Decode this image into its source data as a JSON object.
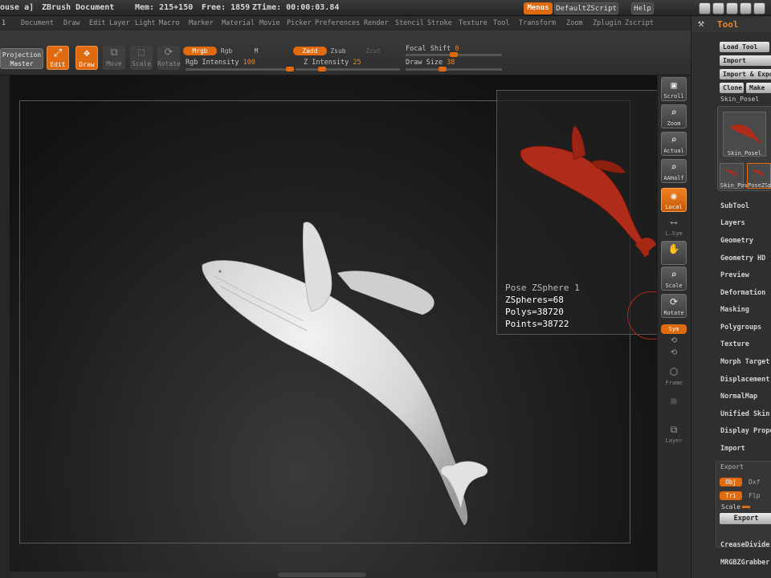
{
  "titlebar": {
    "doc_fragment": "ouse a]",
    "doc_title": "ZBrush Document",
    "mem": "Mem: 215+150",
    "free": "Free: 1859",
    "ztime": "ZTime: 00:00:03.84",
    "menus_btn": "Menus",
    "script_btn": "DefaultZScript",
    "help_btn": "Help"
  },
  "menubar": {
    "items": [
      "Document",
      "Draw",
      "Edit",
      "Layer",
      "Light",
      "Macro",
      "Marker",
      "Material",
      "Movie",
      "Picker",
      "Preferences",
      "Render",
      "Stencil",
      "Stroke",
      "Texture",
      "Tool",
      "Transform",
      "Zoom",
      "Zplugin",
      "Zscript"
    ]
  },
  "toolbar": {
    "projection_master": "Projection Master",
    "edit": "Edit",
    "draw": "Draw",
    "move": "Move",
    "scale": "Scale",
    "rotate": "Rotate",
    "mrgb": "Mrgb",
    "rgb": "Rgb",
    "m": "M",
    "zadd": "Zadd",
    "zsub": "Zsub",
    "zcut": "Zcut",
    "rgb_intensity_label": "Rgb Intensity",
    "rgb_intensity_value": "100",
    "z_intensity_label": "Z Intensity",
    "z_intensity_value": "25",
    "focal_shift_label": "Focal Shift",
    "focal_shift_value": "0",
    "draw_size_label": "Draw Size",
    "draw_size_value": "38",
    "rgb_intensity_level": 1.0,
    "z_intensity_level": 0.25,
    "draw_size_level": 0.38
  },
  "inset": {
    "info_title": "Pose ZSphere 1",
    "zspheres": "ZSpheres=68",
    "polys": "Polys=38720",
    "points": "Points=38722"
  },
  "shelf": {
    "scroll": "Scroll",
    "zoom": "Zoom",
    "actual": "Actual",
    "aahalf": "AAHalf",
    "local": "Local",
    "lsym": "L.Sym",
    "scale": "Scale",
    "rotate": "Rotate",
    "sym_pill": "Sym",
    "frame": "Frame",
    "layer": "Layer"
  },
  "tool_panel": {
    "title": "Tool",
    "load_tool": "Load Tool",
    "import": "Import",
    "import_export": "Import & Export",
    "clone": "Clone",
    "make": "Make",
    "current_tool": "Skin_Posel",
    "thumb_main": "Skin_Posel",
    "thumb_1": "Skin_Pos",
    "thumb_2": "PoseZSp",
    "sections": [
      "SubTool",
      "Layers",
      "Geometry",
      "Geometry HD",
      "Preview",
      "Deformation",
      "Masking",
      "Polygroups",
      "Texture",
      "Morph Target",
      "Displacement",
      "NormalMap",
      "Unified Skin",
      "Display Properties",
      "Import"
    ],
    "export": {
      "header": "Export",
      "obj": "Obj",
      "dxf": "Dxf",
      "tri": "Tri",
      "flp": "Flp",
      "scale": "Scale",
      "button": "Export"
    },
    "crease": "CreaseDivide",
    "mrgbzgrabber": "MRGBZGrabber"
  }
}
